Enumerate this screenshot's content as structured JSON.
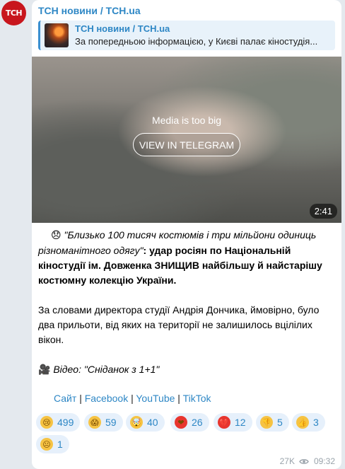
{
  "channel": {
    "avatar_text": "ТСН",
    "name": "ТСН новини / ТСН.ua"
  },
  "reply": {
    "title": "ТСН новини / ТСН.ua",
    "text": "За попередньою інформацією, у Києві палає кіностудія..."
  },
  "media": {
    "message": "Media is too big",
    "button_label": "VIEW IN TELEGRAM",
    "duration": "2:41"
  },
  "post": {
    "emoji_sad": "😞",
    "quote": "\"Близько 100 тисяч костюмів і три мільйони одиниць різноманітного одягу\"",
    "bold_rest": ": удар росіян по Національній кіностудії ім. Довженка ЗНИЩИВ найбільшу й найстарішу костюмну колекцію України.",
    "paragraph2": "За словами директора студії Андрія Дончика, ймовірно, було два прильоти, від яких на території не залишилось вцілілих вікон.",
    "emoji_camera": "🎥",
    "video_credit": "Відео: \"Сніданок з 1+1\""
  },
  "links": {
    "site": "Сайт",
    "facebook": "Facebook",
    "youtube": "YouTube",
    "tiktok": "TikTok",
    "separator": "|"
  },
  "reactions": [
    {
      "icon": "crying-face-icon",
      "emoji": "😢",
      "count": "499",
      "color": "#f6c343"
    },
    {
      "icon": "screaming-face-icon",
      "emoji": "😱",
      "count": "59",
      "color": "#f6c343"
    },
    {
      "icon": "exploding-head-icon",
      "emoji": "🤯",
      "count": "40",
      "color": "#f6c343"
    },
    {
      "icon": "red-heart-icon",
      "emoji": "❤",
      "count": "26",
      "color": "#e8352e"
    },
    {
      "icon": "broken-heart-icon",
      "emoji": "💔",
      "count": "12",
      "color": "#e8352e"
    },
    {
      "icon": "thumbs-down-icon",
      "emoji": "👎",
      "count": "5",
      "color": "#f6c343"
    },
    {
      "icon": "thumbs-up-icon",
      "emoji": "👍",
      "count": "3",
      "color": "#f6c343"
    },
    {
      "icon": "neutral-face-icon",
      "emoji": "😐",
      "count": "1",
      "color": "#f6c343"
    }
  ],
  "footer": {
    "views": "27K",
    "time": "09:32"
  },
  "colors": {
    "accent": "#2e87c5",
    "bubble": "#ffffff",
    "background": "#e4e9ee",
    "reaction_bg": "#e6f0fb"
  }
}
